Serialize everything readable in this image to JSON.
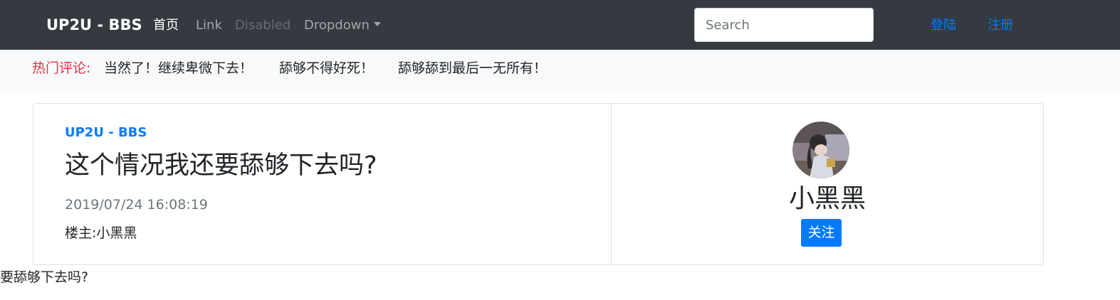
{
  "navbar": {
    "brand": "UP2U - BBS",
    "links": [
      {
        "label": "首页",
        "active": true
      },
      {
        "label": "Link"
      },
      {
        "label": "Disabled",
        "disabled": true
      },
      {
        "label": "Dropdown",
        "dropdown": true
      }
    ],
    "search_placeholder": "Search",
    "login": "登陆",
    "register": "注册"
  },
  "hot_comments": {
    "label": "热门评论:",
    "items": [
      "当然了！继续卑微下去！",
      "舔够不得好死！",
      "舔够舔到最后一无所有！"
    ]
  },
  "post": {
    "site": "UP2U - BBS",
    "title": "这个情况我还要舔够下去吗?",
    "time": "2019/07/24 16:08:19",
    "author_label": "楼主:",
    "author_name": "小黑黑"
  },
  "user": {
    "name": "小黑黑",
    "follow_label": "关注"
  },
  "overflow_text": "我还要舔够下去吗?",
  "colors": {
    "navbar_bg": "#343a40",
    "primary": "#007bff",
    "danger": "#dc3545",
    "muted": "#6c757d",
    "light_bg": "#f8f9fa"
  }
}
